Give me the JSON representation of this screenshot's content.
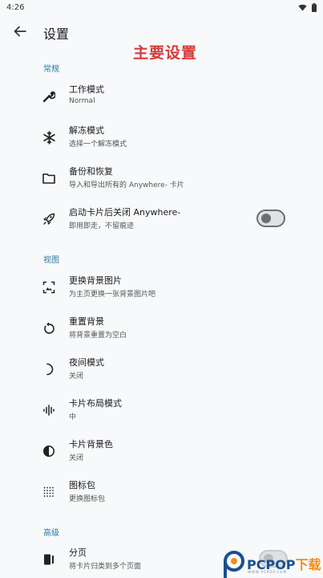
{
  "status_bar": {
    "time": "4:26"
  },
  "app_bar": {
    "title": "设置"
  },
  "overlay_title": "主要设置",
  "sections": {
    "general": "常规",
    "view": "视图",
    "advanced": "高级"
  },
  "rows": {
    "work_mode": {
      "title": "工作模式",
      "subtitle": "Normal"
    },
    "unfreeze_mode": {
      "title": "解冻模式",
      "subtitle": "选择一个解冻模式"
    },
    "backup_restore": {
      "title": "备份和恢复",
      "subtitle": "导入和导出所有的 Anywhere- 卡片"
    },
    "close_after_launch": {
      "title": "启动卡片后关闭 Anywhere-",
      "subtitle": "即用即走，不留痕迹",
      "toggle_on": false
    },
    "change_background": {
      "title": "更换背景图片",
      "subtitle": "为主页更换一张背景图片吧"
    },
    "reset_background": {
      "title": "重置背景",
      "subtitle": "将背景重置为空白"
    },
    "night_mode": {
      "title": "夜间模式",
      "subtitle": "关闭"
    },
    "card_layout": {
      "title": "卡片布局模式",
      "subtitle": "中"
    },
    "card_bg_color": {
      "title": "卡片背景色",
      "subtitle": "关闭"
    },
    "icon_pack": {
      "title": "图标包",
      "subtitle": "更换图标包"
    },
    "paging": {
      "title": "分页",
      "subtitle": "将卡片归类到多个页面",
      "toggle_on": false
    }
  },
  "watermark": {
    "brand": "PCPOP",
    "suffix": "下载",
    "tagline": "WWW.PCPOP.COM"
  },
  "colors": {
    "background": "#f7f9fa",
    "section_header": "#2a7aa0",
    "overlay_title": "#d93a3a",
    "switch_off": "#6b6f73"
  }
}
